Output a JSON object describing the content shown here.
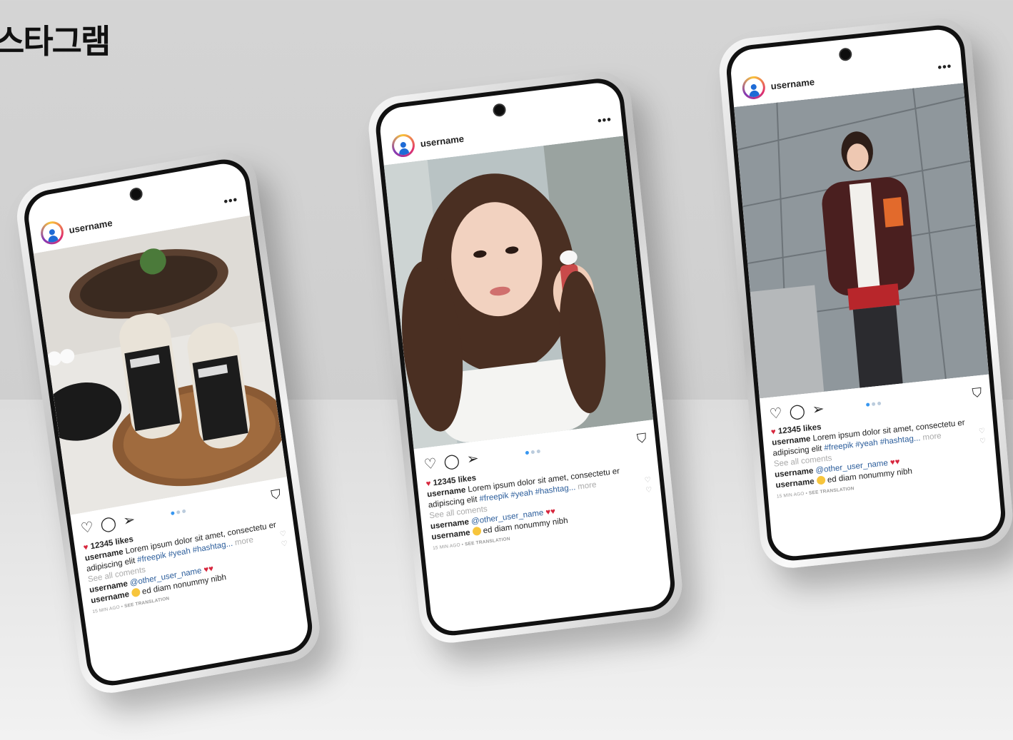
{
  "page": {
    "title": "스타그램"
  },
  "colors": {
    "accent": "#3897f0",
    "tag": "#2b5d9b",
    "heart": "#d7263d"
  },
  "phones": [
    {
      "username": "username",
      "more_icon": "•••",
      "likes": "12345 likes",
      "caption_user": "username",
      "caption_text": "Lorem ipsum dolor sit amet, consectetu er adipiscing elit",
      "hashtags": "#freepik #yeah #hashtag...",
      "more_link": "more",
      "see_all": "See all coments",
      "comment1_user": "username",
      "comment1_mention": "@other_user_name",
      "comment2_user": "username",
      "comment2_text": "ed diam nonummy nibh",
      "meta": "15 MIN AGO •",
      "see_translation": "SEE TRANSLATION",
      "photo_alt": "hair dye product canisters on wooden tray"
    },
    {
      "username": "username",
      "more_icon": "•••",
      "likes": "12345 likes",
      "caption_user": "username",
      "caption_text": "Lorem ipsum dolor sit amet, consectetu er adipiscing elit",
      "hashtags": "#freepik #yeah #hashtag...",
      "more_link": "more",
      "see_all": "See all coments",
      "comment1_user": "username",
      "comment1_mention": "@other_user_name",
      "comment2_user": "username",
      "comment2_text": "ed diam nonummy nibh",
      "meta": "15 MIN AGO •",
      "see_translation": "SEE TRANSLATION",
      "photo_alt": "woman holding small perfume bottle"
    },
    {
      "username": "username",
      "more_icon": "•••",
      "likes": "12345 likes",
      "caption_user": "username",
      "caption_text": "Lorem ipsum dolor sit amet, consectetu er adipiscing elit",
      "hashtags": "#freepik #yeah #hashtag...",
      "more_link": "more",
      "see_all": "See all coments",
      "comment1_user": "username",
      "comment1_mention": "@other_user_name",
      "comment2_user": "username",
      "comment2_text": "ed diam nonummy nibh",
      "meta": "15 MIN AGO •",
      "see_translation": "SEE TRANSLATION",
      "photo_alt": "woman in fleece jacket against grey panel wall"
    }
  ]
}
